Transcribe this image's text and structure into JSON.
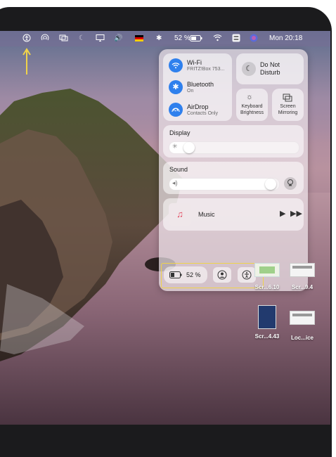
{
  "menubar": {
    "battery_percent": "52 %",
    "clock": "Mon 20:18"
  },
  "control_center": {
    "wifi": {
      "label": "Wi-Fi",
      "sub": "FRITZ!Box 753..."
    },
    "bluetooth": {
      "label": "Bluetooth",
      "sub": "On"
    },
    "airdrop": {
      "label": "AirDrop",
      "sub": "Contacts Only"
    },
    "dnd": {
      "label_line1": "Do Not",
      "label_line2": "Disturb"
    },
    "keyboard": {
      "label_line1": "Keyboard",
      "label_line2": "Brightness"
    },
    "mirroring": {
      "label_line1": "Screen",
      "label_line2": "Mirroring"
    },
    "display": {
      "label": "Display",
      "level": 0.12
    },
    "sound": {
      "label": "Sound",
      "level": 0.97
    },
    "music": {
      "label": "Music"
    },
    "battery": {
      "label": "52 %"
    }
  },
  "desktop_files": [
    {
      "label": "Scr...6.10"
    },
    {
      "label": "Scr...9.4"
    },
    {
      "label": "Scr...4.43"
    },
    {
      "label": "Loc...ice"
    }
  ],
  "colors": {
    "accent": "#2f80ed",
    "highlight": "#f0d34a"
  }
}
